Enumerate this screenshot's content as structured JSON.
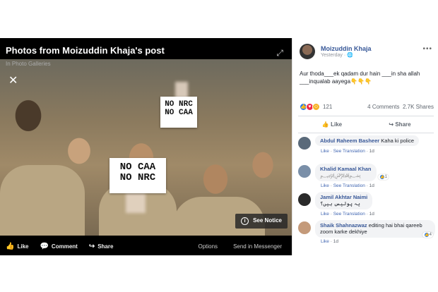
{
  "viewer": {
    "title": "Photos from Moizuddin Khaja's post",
    "subtitle": "In Photo Galleries",
    "close_icon": "close-icon",
    "expand_icon": "expand-icon",
    "signs": [
      {
        "text": "NO NRC\nNO CAA"
      },
      {
        "text": "NO CAA\nNO NRC"
      }
    ],
    "see_notice": "See Notice",
    "actions": [
      {
        "label": "Like",
        "icon": "like-icon"
      },
      {
        "label": "Comment",
        "icon": "comment-icon"
      },
      {
        "label": "Share",
        "icon": "share-icon"
      }
    ],
    "options": "Options",
    "send": "Send in Messenger"
  },
  "post": {
    "author": "Moizuddin Khaja",
    "time": "Yesterday · ",
    "more": "•••",
    "text": "Aur thoda___ek qadam dur hain ___in sha allah ___inqualab aayega👇👇👇",
    "reaction_count": "121",
    "comments_count": "4 Comments",
    "shares_count": "2.7K Shares",
    "like_label": "Like",
    "share_label": "Share"
  },
  "comments": [
    {
      "name": "Abdul Raheem Basheer",
      "text": "Kaha ki police",
      "like": "Like",
      "translate": "See Translation",
      "age": "1d",
      "avatar_color": "#5a6a7a"
    },
    {
      "name": "Khalid Kamaal Khan",
      "text": "",
      "like": "Like",
      "translate": "See Translation",
      "age": "1d",
      "avatar_color": "#7a8fa8",
      "reactions": "1"
    },
    {
      "name": "Jamil Akhtar Naimi",
      "text": "یہ پولیس ہیں؟",
      "like": "Like",
      "translate": "See Translation",
      "age": "1d",
      "avatar_color": "#2a2a2a"
    },
    {
      "name": "Shaik Shahnazwaz",
      "text": "editing hai bhai qareeb zoom karke dekhiye",
      "like": "Like",
      "translate": "",
      "age": "1d",
      "avatar_color": "#c49a7a",
      "reactions": "4"
    }
  ]
}
